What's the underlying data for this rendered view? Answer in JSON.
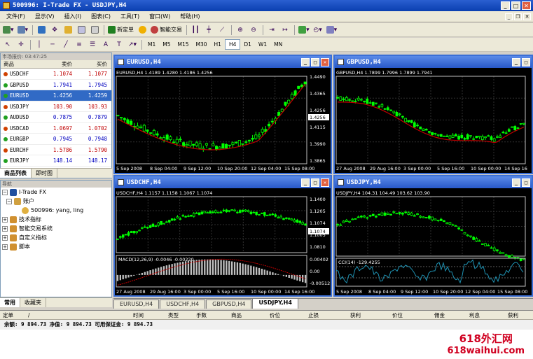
{
  "window": {
    "title": "500996: I-Trade FX - USDJPY,H4"
  },
  "menu": [
    "文件(F)",
    "显示(V)",
    "插入(I)",
    "图表(C)",
    "工具(T)",
    "窗口(W)",
    "帮助(H)"
  ],
  "toolbar": {
    "new_order": "新定单",
    "expert_advisors": "智能交易",
    "timeframes": [
      "M1",
      "M5",
      "M15",
      "M30",
      "H1",
      "H4",
      "D1",
      "W1",
      "MN"
    ],
    "active_timeframe": "H4"
  },
  "market_watch": {
    "header": "市场报价: 03:47:25",
    "columns": [
      "商品",
      "卖价",
      "买价"
    ],
    "rows": [
      {
        "symbol": "USDCHF",
        "bid": "1.1074",
        "ask": "1.1077",
        "dir": "down"
      },
      {
        "symbol": "GBPUSD",
        "bid": "1.7941",
        "ask": "1.7945",
        "dir": "up"
      },
      {
        "symbol": "EURUSD",
        "bid": "1.4256",
        "ask": "1.4259",
        "dir": "up",
        "selected": true
      },
      {
        "symbol": "USDJPY",
        "bid": "103.90",
        "ask": "103.93",
        "dir": "down"
      },
      {
        "symbol": "AUDUSD",
        "bid": "0.7875",
        "ask": "0.7879",
        "dir": "up"
      },
      {
        "symbol": "USDCAD",
        "bid": "1.0697",
        "ask": "1.0702",
        "dir": "down"
      },
      {
        "symbol": "EURGBP",
        "bid": "0.7945",
        "ask": "0.7948",
        "dir": "up"
      },
      {
        "symbol": "EURCHF",
        "bid": "1.5786",
        "ask": "1.5790",
        "dir": "down"
      },
      {
        "symbol": "EURJPY",
        "bid": "148.14",
        "ask": "148.17",
        "dir": "up"
      }
    ],
    "tabs": [
      "商品列表",
      "即时图"
    ]
  },
  "navigator": {
    "header": "导航",
    "root": "I-Trade FX",
    "accounts": "账户",
    "account_entry": "500996: yang, ling",
    "items": [
      "技术指标",
      "智能交易系统",
      "自定义指标",
      "脚本"
    ],
    "tabs": [
      "常用",
      "收藏夹"
    ]
  },
  "charts": [
    {
      "title": "EURUSD,H4",
      "info": "EURUSD,H4 1.4189 1.4280 1.4186 1.4256",
      "price_labels": [
        "1.4490",
        "1.4365",
        "1.4256",
        "1.4115",
        "1.3990",
        "1.3865"
      ],
      "current": "1.4256",
      "time_labels": [
        "5 Sep 2008",
        "8 Sep 04:00",
        "9 Sep 12:00",
        "10 Sep 20:00",
        "12 Sep 04:00",
        "15 Sep 08:00"
      ]
    },
    {
      "title": "GBPUSD,H4",
      "info": "GBPUSD,H4 1.7899 1.7996 1.7899 1.7941",
      "price_labels": [],
      "time_labels": [
        "27 Aug 2008",
        "29 Aug 16:00",
        "3 Sep 00:00",
        "5 Sep 16:00",
        "10 Sep 00:00",
        "14 Sep 16"
      ]
    },
    {
      "title": "USDCHF,H4",
      "info": "USDCHF,H4 1.1157 1.1158 1.1067 1.1074",
      "price_labels": [
        "1.1400",
        "1.1205",
        "1.1074",
        "1.1005",
        "1.0810"
      ],
      "current": "1.1074",
      "macd_info": "MACD(12,26,9) -0.0046 -0.00220",
      "macd_labels": [
        "0.00402",
        "0.00",
        "-0.00512"
      ],
      "time_labels": [
        "27 Aug 2008",
        "29 Aug 16:00",
        "3 Sep 00:00",
        "5 Sep 16:00",
        "10 Sep 00:00",
        "14 Sep 16:00"
      ]
    },
    {
      "title": "USDJPY,H4",
      "info": "USDJPY,H4 104.31 104.49 103.62 103.90",
      "cci_info": "CCI(14) -129.4255",
      "time_labels": [
        "5 Sep 2008",
        "8 Sep 04:00",
        "9 Sep 12:00",
        "10 Sep 20:00",
        "12 Sep 04:00",
        "15 Sep 08:00"
      ]
    }
  ],
  "chart_tabs": [
    "EURUSD,H4",
    "USDCHF,H4",
    "GBPUSD,H4",
    "USDJPY,H4"
  ],
  "active_chart_tab": "USDJPY,H4",
  "terminal": {
    "columns": [
      "定单",
      "/",
      "时间",
      "类型",
      "手数",
      "商品",
      "价位",
      "止损",
      "获利",
      "价位",
      "佣金",
      "利息",
      "获利"
    ],
    "balance_line": "余额: 9 894.73  净值: 9 894.73  可用保证金: 9 894.73"
  },
  "watermark": {
    "cn": "618外汇网",
    "url": "618waihui.com"
  },
  "colors": {
    "bull": "#00ff00",
    "bear": "#000000",
    "ma": "#c00000",
    "grid": "#404040",
    "accent": "#3b6fd6"
  }
}
